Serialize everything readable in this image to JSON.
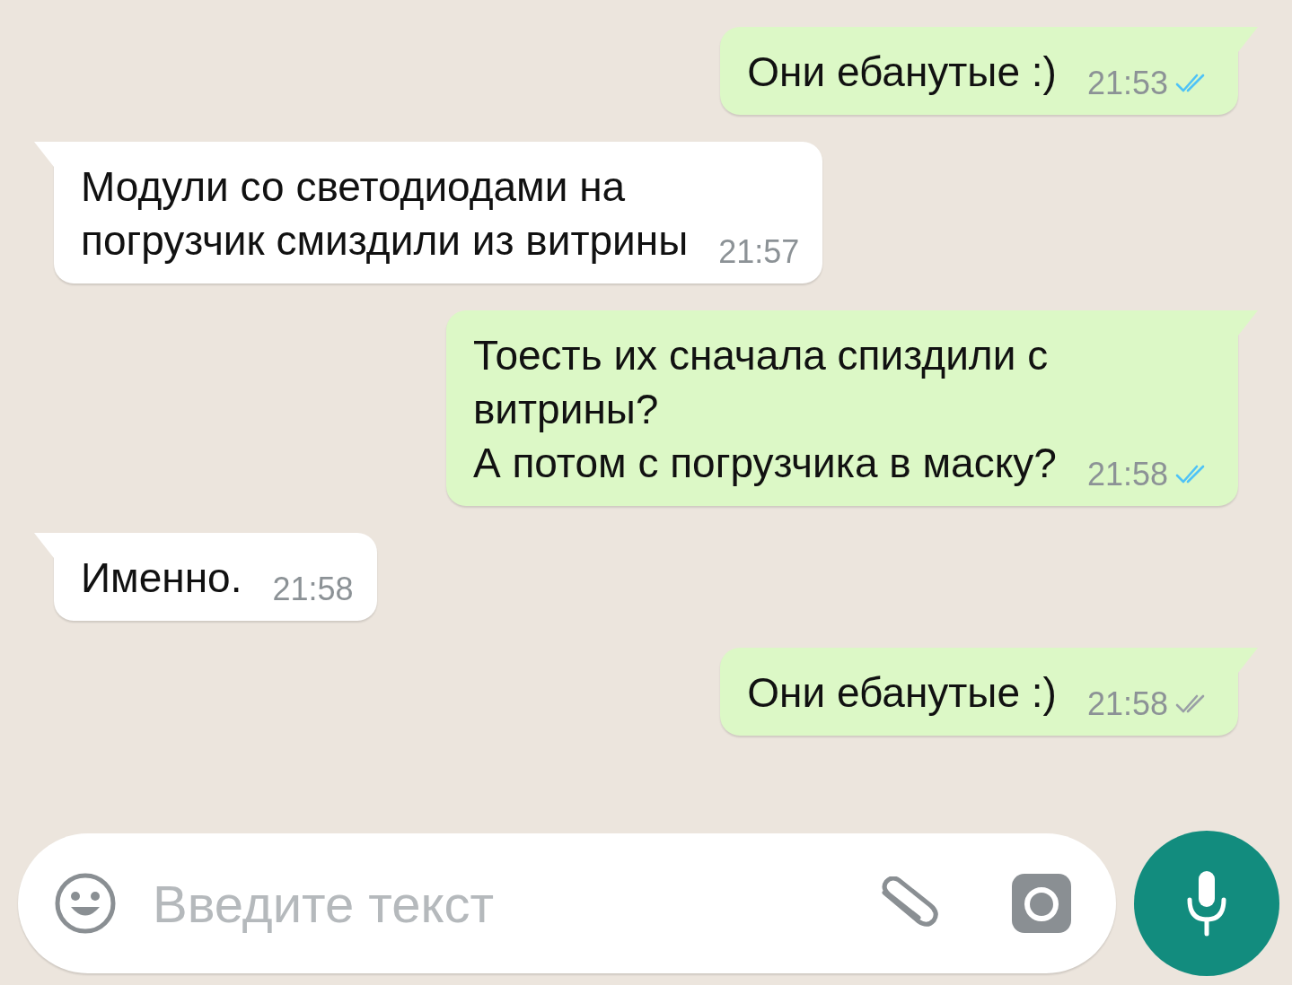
{
  "messages": [
    {
      "kind": "outgoing",
      "text": "Они ебанутые :)",
      "time": "21:53",
      "read": true
    },
    {
      "kind": "incoming",
      "text": "Модули со светодиодами на\nпогрузчик смиздили из витрины",
      "time": "21:57"
    },
    {
      "kind": "outgoing",
      "text": "Тоесть их сначала спиздили с\nвитрины?\nА потом с погрузчика в маску?",
      "time": "21:58",
      "read": true
    },
    {
      "kind": "incoming",
      "text": "Именно.",
      "time": "21:58"
    },
    {
      "kind": "outgoing",
      "text": "Они ебанутые :)",
      "time": "21:58",
      "read": false
    }
  ],
  "composer": {
    "placeholder": "Введите текст"
  }
}
